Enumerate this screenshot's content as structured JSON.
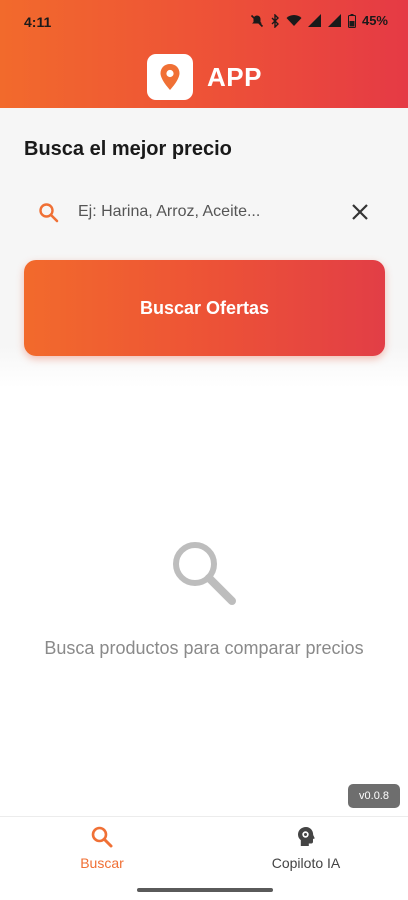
{
  "status_bar": {
    "time": "4:11",
    "battery": "45%"
  },
  "app": {
    "name": "APP"
  },
  "search": {
    "title": "Busca el mejor precio",
    "placeholder": "Ej: Harina, Arroz, Aceite...",
    "button_label": "Buscar Ofertas"
  },
  "empty_state": {
    "message": "Busca productos para comparar precios"
  },
  "version": "v0.0.8",
  "bottom_nav": {
    "items": [
      {
        "label": "Buscar",
        "icon": "search-icon",
        "active": true
      },
      {
        "label": "Copiloto IA",
        "icon": "ai-brain-icon",
        "active": false
      }
    ]
  },
  "colors": {
    "accent": "#f07035",
    "gradient_start": "#f26a2c",
    "gradient_end": "#e53a45"
  }
}
